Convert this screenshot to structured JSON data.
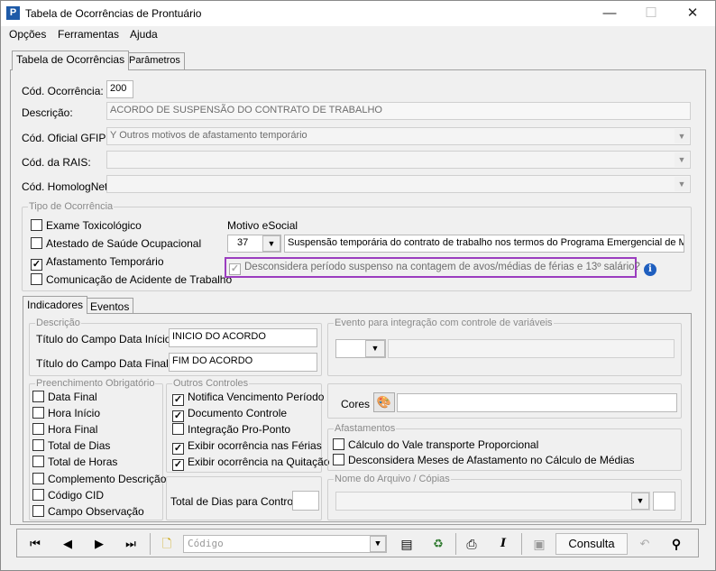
{
  "window": {
    "title": "Tabela de Ocorrências de Prontuário",
    "minimize": "—",
    "maximize": "☐",
    "close": "✕"
  },
  "menu": {
    "opcoes": "Opções",
    "ferramentas": "Ferramentas",
    "ajuda": "Ajuda"
  },
  "tabs": {
    "tabela": "Tabela de Ocorrências",
    "parametros": "Parâmetros"
  },
  "form": {
    "cod_ocorrencia_label": "Cód. Ocorrência:",
    "cod_ocorrencia_value": "200",
    "descricao_label": "Descrição:",
    "descricao_value": "ACORDO DE SUSPENSÃO DO CONTRATO DE TRABALHO",
    "gfip_label": "Cód. Oficial GFIP:",
    "gfip_value": "Y  Outros motivos de afastamento temporário",
    "rais_label": "Cód. da RAIS:",
    "rais_value": "",
    "homolognet_label": "Cód. HomologNet:",
    "homolognet_value": ""
  },
  "tipo": {
    "legend": "Tipo de Ocorrência",
    "exame": "Exame Toxicológico",
    "exame_checked": false,
    "atestado": "Atestado de Saúde Ocupacional",
    "atestado_checked": false,
    "afastamento": "Afastamento Temporário",
    "afastamento_checked": true,
    "comunicacao": "Comunicação de Acidente de Trabalho",
    "comunicacao_checked": false,
    "motivo_label": "Motivo eSocial",
    "motivo_code": "37",
    "motivo_desc": "Suspensão temporária do contrato de trabalho nos termos do Programa Emergencial de Ma",
    "desconsidera": "Desconsidera período suspenso na contagem de avos/médias de férias e 13º salário?",
    "desconsidera_checked": true
  },
  "subtabs": {
    "indicadores": "Indicadores",
    "eventos": "Eventos"
  },
  "descricao_group": {
    "legend": "Descrição",
    "inicio_label": "Título do Campo Data Início:",
    "inicio_value": "INICIO DO ACORDO",
    "final_label": "Título do Campo Data Final:",
    "final_value": "FIM DO ACORDO"
  },
  "evento_group": {
    "legend": "Evento para integração com controle de variáveis"
  },
  "preenchimento": {
    "legend": "Preenchimento Obrigatório",
    "items": [
      "Data Final",
      "Hora Início",
      "Hora Final",
      "Total de Dias",
      "Total de Horas",
      "Complemento Descrição",
      "Código CID",
      "Campo Observação"
    ]
  },
  "outros": {
    "legend": "Outros Controles",
    "items": [
      "Notifica Vencimento Período",
      "Documento Controle",
      "Integração Pro-Ponto",
      "Exibir ocorrência nas Férias",
      "Exibir ocorrência na Quitação"
    ],
    "checked": [
      true,
      true,
      false,
      true,
      true
    ],
    "total_label": "Total de Dias para Controle:",
    "total_value": ""
  },
  "cores": {
    "label": "Cores"
  },
  "afastamentos": {
    "legend": "Afastamentos",
    "vale": "Cálculo do Vale transporte Proporcional",
    "desconsidera": "Desconsidera Meses de Afastamento no Cálculo de Médias"
  },
  "arquivo": {
    "legend": "Nome do Arquivo / Cópias"
  },
  "navbar": {
    "first": "⏮",
    "prev": "◀",
    "next": "▶",
    "last": "⏭",
    "new": "🗋",
    "codigo_placeholder": "Código",
    "consulta": "Consulta",
    "italic": "I",
    "binoculars": "👀"
  }
}
